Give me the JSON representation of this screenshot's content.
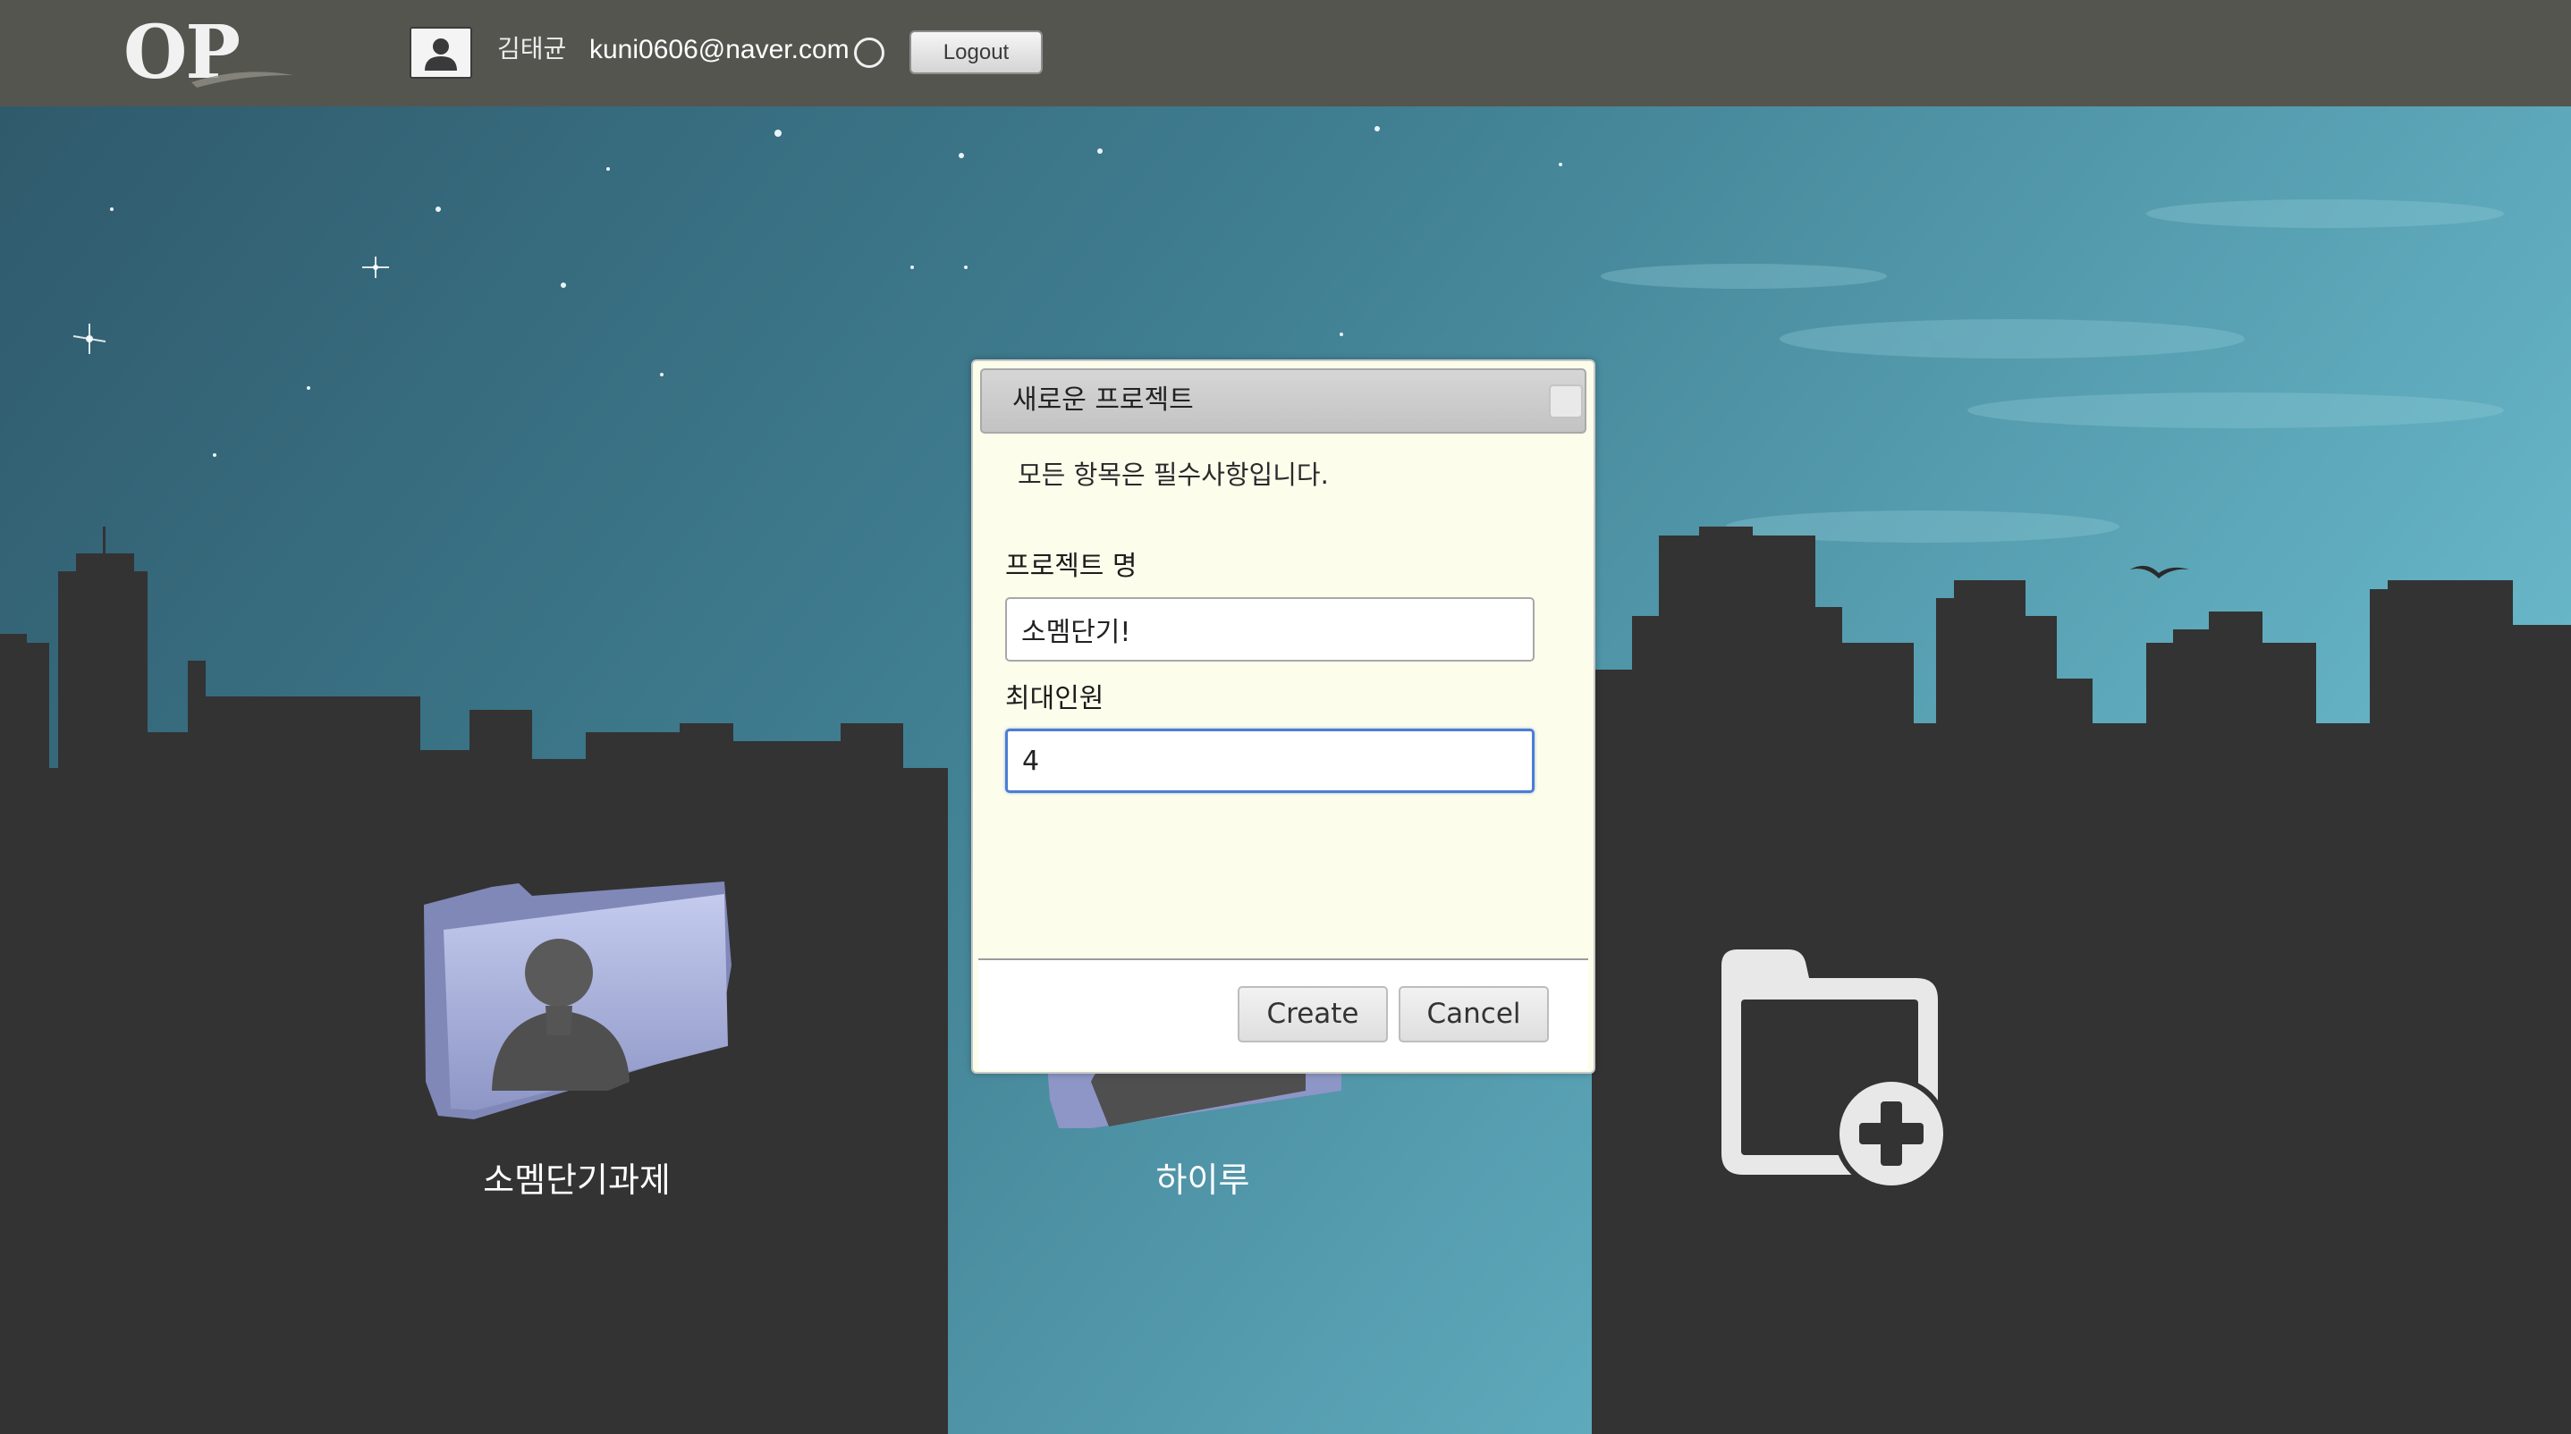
{
  "header": {
    "logo_text": "OP",
    "user_name": "김태균",
    "user_email": "kuni0606@naver.com",
    "logout_label": "Logout"
  },
  "projects": [
    {
      "label": "소멤단기과제"
    },
    {
      "label": "하이루"
    }
  ],
  "new_project_icon": "folder-plus-icon",
  "dialog": {
    "title": "새로운 프로젝트",
    "hint": "모든 항목은 필수사항입니다.",
    "fields": {
      "project_name_label": "프로젝트 명",
      "project_name_value": "소멤단기!",
      "max_members_label": "최대인원",
      "max_members_value": "4"
    },
    "create_label": "Create",
    "cancel_label": "Cancel"
  },
  "colors": {
    "topbar": "#55554f",
    "sky": "#4a8ea0",
    "ground": "#333333",
    "dialog_bg": "#fdfdec",
    "focus_border": "#4b7dd3"
  }
}
